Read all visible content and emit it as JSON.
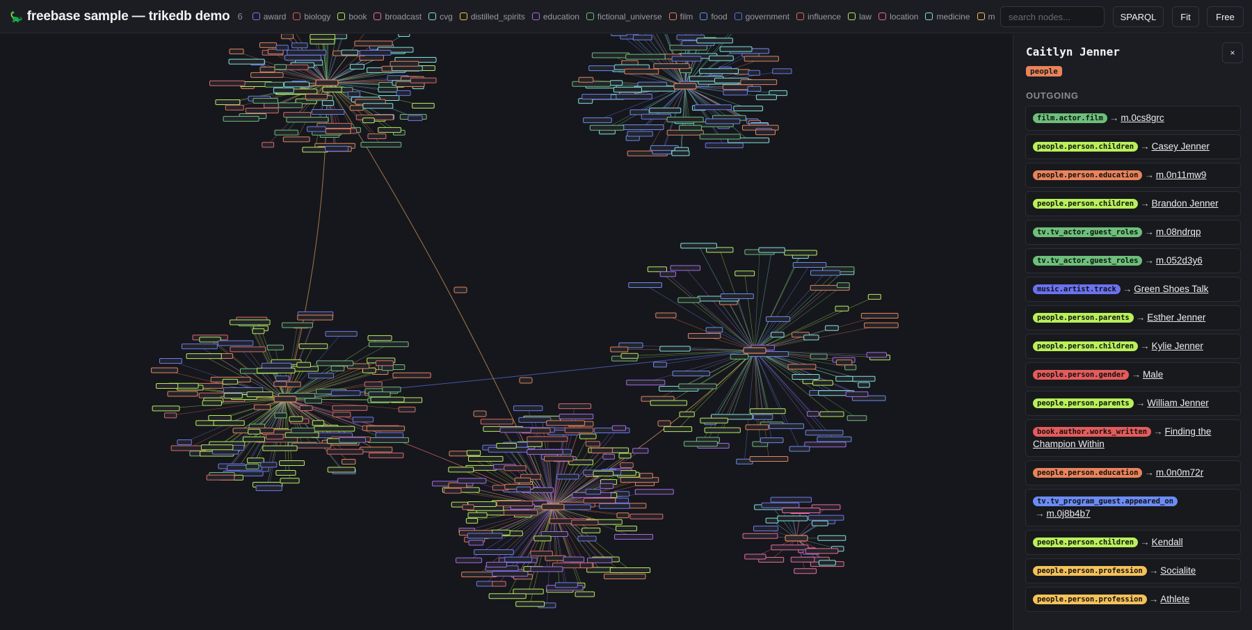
{
  "header": {
    "logo_icon": "dinosaur-icon",
    "title": "freebase sample — trikedb demo",
    "count": "6",
    "legend": [
      {
        "label": "award",
        "color": "#6b7bf5"
      },
      {
        "label": "biology",
        "color": "#e55b5b"
      },
      {
        "label": "book",
        "color": "#b8f05a"
      },
      {
        "label": "broadcast",
        "color": "#f06aa2"
      },
      {
        "label": "cvg",
        "color": "#7ee6e0"
      },
      {
        "label": "distilled_spirits",
        "color": "#f5c15a"
      },
      {
        "label": "education",
        "color": "#a86af0"
      },
      {
        "label": "fictional_universe",
        "color": "#6cc07a"
      },
      {
        "label": "film",
        "color": "#e9835a"
      },
      {
        "label": "food",
        "color": "#6b8cf5"
      },
      {
        "label": "government",
        "color": "#5b72e0"
      },
      {
        "label": "influence",
        "color": "#e06a6a"
      },
      {
        "label": "law",
        "color": "#b8f05a"
      },
      {
        "label": "location",
        "color": "#f06a8c"
      },
      {
        "label": "medicine",
        "color": "#7ee6e0"
      },
      {
        "label": "mete",
        "color": "#f5c15a"
      }
    ],
    "search_placeholder": "search nodes...",
    "sparql_label": "SPARQL",
    "fit_label": "Fit",
    "free_label": "Free"
  },
  "panel": {
    "close_label": "×",
    "node_name": "Caitlyn Jenner",
    "node_type": "people",
    "section_title": "OUTGOING",
    "edges": [
      {
        "predicate": "film.actor.film",
        "color": "#6cc07a",
        "target": "m.0cs8grc"
      },
      {
        "predicate": "people.person.children",
        "color": "#b8f05a",
        "target": "Casey Jenner"
      },
      {
        "predicate": "people.person.education",
        "color": "#e9835a",
        "target": "m.0n11mw9"
      },
      {
        "predicate": "people.person.children",
        "color": "#b8f05a",
        "target": "Brandon Jenner"
      },
      {
        "predicate": "tv.tv_actor.guest_roles",
        "color": "#6cc07a",
        "target": "m.08ndrqp"
      },
      {
        "predicate": "tv.tv_actor.guest_roles",
        "color": "#6cc07a",
        "target": "m.052d3y6"
      },
      {
        "predicate": "music.artist.track",
        "color": "#6b72f0",
        "target": "Green Shoes Talk"
      },
      {
        "predicate": "people.person.parents",
        "color": "#b8f05a",
        "target": "Esther Jenner"
      },
      {
        "predicate": "people.person.children",
        "color": "#b8f05a",
        "target": "Kylie Jenner"
      },
      {
        "predicate": "people.person.gender",
        "color": "#e55b5b",
        "target": "Male"
      },
      {
        "predicate": "people.person.parents",
        "color": "#b8f05a",
        "target": "William Jenner"
      },
      {
        "predicate": "book.author.works_written",
        "color": "#e55b5b",
        "target": "Finding the Champion Within"
      },
      {
        "predicate": "people.person.education",
        "color": "#e9835a",
        "target": "m.0n0m72r"
      },
      {
        "predicate": "tv.tv_program_guest.appeared_on",
        "color": "#6b8cf5",
        "target": "m.0j8b4b7"
      },
      {
        "predicate": "people.person.children",
        "color": "#b8f05a",
        "target": "Kendall"
      },
      {
        "predicate": "people.person.profession",
        "color": "#f5c15a",
        "target": "Socialite"
      },
      {
        "predicate": "people.person.profession",
        "color": "#f5c15a",
        "target": "Athlete"
      }
    ]
  }
}
